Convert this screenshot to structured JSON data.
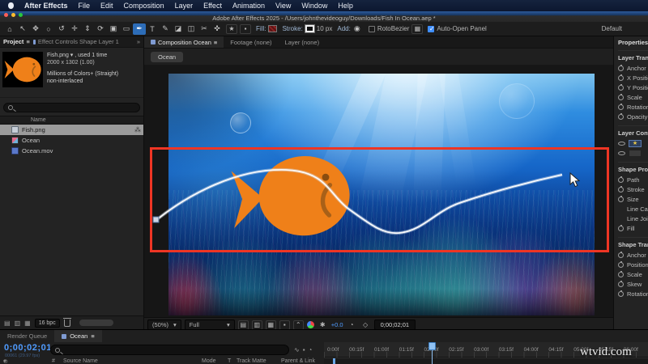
{
  "menubar": {
    "items": [
      "After Effects",
      "File",
      "Edit",
      "Composition",
      "Layer",
      "Effect",
      "Animation",
      "View",
      "Window",
      "Help"
    ]
  },
  "titlebar": {
    "title": "Adobe After Effects 2025 -  /Users/johnthevideoguy/Downloads/Fish In Ocean.aep *"
  },
  "icons": {
    "burger": "≡",
    "caret": "▾",
    "chevrons": "»",
    "star": "★",
    "add_circle": "◉",
    "grid": "▤",
    "grid2": "▥",
    "grid3": "▦",
    "collapse": "⌃",
    "hash": "#",
    "note": "♪",
    "dot": "●",
    "box": "▪",
    "wave": "∿",
    "key": "◇",
    "graph": "◔"
  },
  "toolbar": {
    "tools": [
      {
        "name": "home",
        "glyph": "⌂"
      },
      {
        "name": "selection",
        "glyph": "↖"
      },
      {
        "name": "hand",
        "glyph": "✥"
      },
      {
        "name": "zoom",
        "glyph": "○"
      },
      {
        "name": "orbit-camera",
        "glyph": "↺"
      },
      {
        "name": "pan-camera",
        "glyph": "✛"
      },
      {
        "name": "dolly-camera",
        "glyph": "⇕"
      },
      {
        "name": "rotation",
        "glyph": "⟳"
      },
      {
        "name": "camera-tool",
        "glyph": "▣"
      },
      {
        "name": "rectangle",
        "glyph": "▭"
      },
      {
        "name": "pen",
        "glyph": "✒"
      },
      {
        "name": "type",
        "glyph": "T"
      },
      {
        "name": "brush",
        "glyph": "✎"
      },
      {
        "name": "clone-stamp",
        "glyph": "◪"
      },
      {
        "name": "eraser",
        "glyph": "◫"
      },
      {
        "name": "roto-brush",
        "glyph": "✂"
      },
      {
        "name": "puppet",
        "glyph": "✜"
      }
    ],
    "active_tool": "pen",
    "fill_label": "Fill:",
    "stroke_label": "Stroke:",
    "stroke_width": "10 px",
    "add_label": "Add:",
    "rotobezier_label": "RotoBezier",
    "auto_open_label": "Auto-Open Panel",
    "workspace": "Default"
  },
  "project": {
    "tab_label": "Project",
    "effect_controls_tab": "Effect Controls Shape Layer 1",
    "selected_item": {
      "line1": "Fish.png ▾ , used 1 time",
      "line2": "2000 x 1302 (1.00)",
      "line3": "Millions of Colors+ (Straight)",
      "line4": "non-interlaced"
    },
    "name_column": "Name",
    "rows": [
      {
        "label": "Fish.png"
      },
      {
        "label": "Ocean"
      },
      {
        "label": "Ocean.mov"
      }
    ],
    "bpc_label": "16 bpc"
  },
  "composition": {
    "tabs": [
      {
        "label": "Composition Ocean"
      },
      {
        "label": "Footage (none)"
      },
      {
        "label": "Layer (none)"
      }
    ],
    "breadcrumb": "Ocean",
    "zoom_value": "(50%)",
    "resolution": "Full",
    "exposure": "+0.0",
    "preview_timecode": "0;00;02;01"
  },
  "properties": {
    "header": "Properties",
    "sections": [
      {
        "title": "Layer Transform",
        "rows": [
          "Anchor Point",
          "X Position",
          "Y Position",
          "Scale",
          "Rotation",
          "Opacity"
        ]
      },
      {
        "title": "Layer Content"
      },
      {
        "title": "Shape Properties",
        "rows": [
          "Path",
          "Stroke",
          "Size",
          "Line Cap",
          "Line Join",
          "Fill"
        ]
      },
      {
        "title": "Shape Transform",
        "rows": [
          "Anchor",
          "Position",
          "Scale",
          "Skew",
          "Rotation"
        ]
      }
    ]
  },
  "timeline": {
    "tabs": [
      {
        "label": "Render Queue"
      },
      {
        "label": "Ocean"
      }
    ],
    "timecode": "0;00;02;01",
    "frame_info": "00061 (29.97 fps)",
    "columns": {
      "hash": "#",
      "source_name": "Source Name",
      "mode": "Mode",
      "t": "T",
      "track_matte": "Track Matte",
      "parent": "Parent & Link"
    },
    "ruler_ticks": [
      "0:00f",
      "00:15f",
      "01:00f",
      "01:15f",
      "02:00f",
      "02:15f",
      "03:00f",
      "03:15f",
      "04:00f",
      "04:15f",
      "05:00f",
      "05:15f",
      "06:00f"
    ]
  },
  "watermark": "wtvid.com",
  "colors": {
    "accent_blue": "#3f8efc",
    "annotation_red": "#ee3524",
    "fish_orange": "#ef8019",
    "timecode_blue": "#4f9bff"
  }
}
